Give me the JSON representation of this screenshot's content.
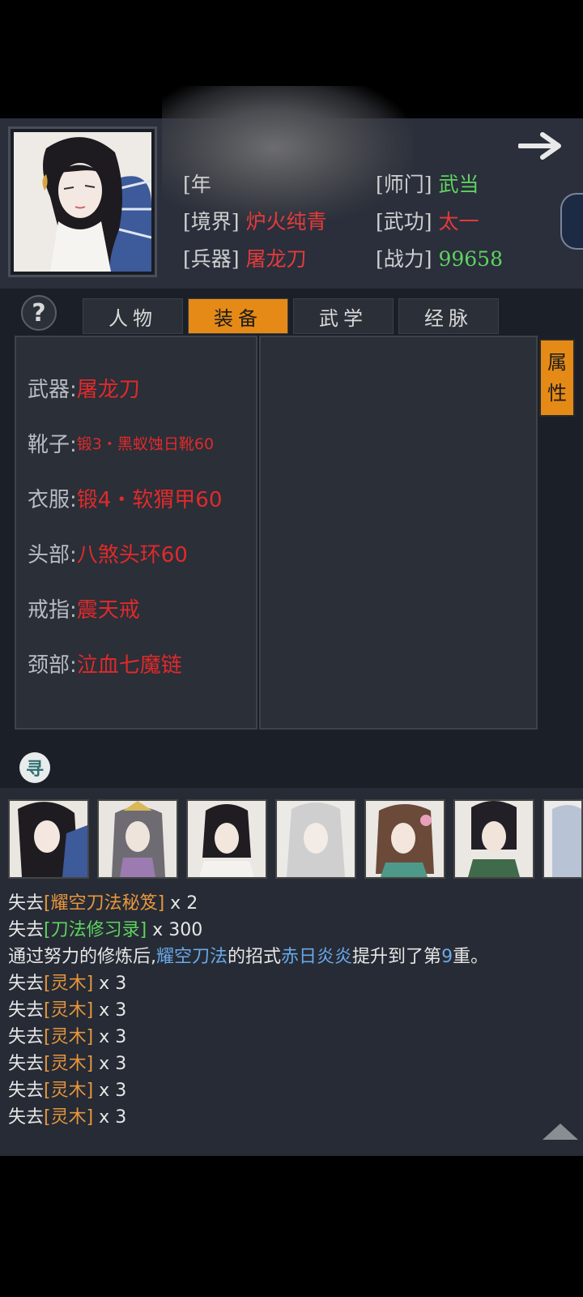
{
  "header": {
    "age_label": "[年",
    "realm_label": "[境界]",
    "realm_value": "炉火纯青",
    "weapon_label": "[兵器]",
    "weapon_value": "屠龙刀",
    "sect_label": "[师门]",
    "sect_value": "武当",
    "skill_label": "[武功]",
    "skill_value": "太一",
    "power_label": "[战力]",
    "power_value": "99658"
  },
  "help_label": "?",
  "tabs": [
    {
      "label": "人物"
    },
    {
      "label": "装备"
    },
    {
      "label": "武学"
    },
    {
      "label": "经脉"
    }
  ],
  "active_tab": "装备",
  "attr_button": {
    "line1": "属",
    "line2": "性"
  },
  "equipment": [
    {
      "label": "武器:",
      "value": "屠龙刀"
    },
    {
      "label": "靴子:",
      "value": "锻3・黑蚁蚀日靴60"
    },
    {
      "label": "衣服:",
      "value": "锻4・软猬甲60"
    },
    {
      "label": "头部:",
      "value": "八煞头环60"
    },
    {
      "label": "戒指:",
      "value": "震天戒"
    },
    {
      "label": "颈部:",
      "value": "泣血七魔链"
    }
  ],
  "log_icon_glyph": "寻",
  "log": {
    "line1": {
      "a": "失去",
      "b": "[耀空刀法秘笈]",
      "c": " x 2"
    },
    "line2": {
      "a": "失去",
      "b": "[刀法修习录]",
      "c": " x 300"
    },
    "line3": {
      "a": "通过努力的修炼后,",
      "b": "耀空刀法",
      "c": "的招式",
      "d": "赤日炎炎",
      "e": "提升到了第",
      "f": "9",
      "g": "重。"
    },
    "wood": {
      "a": "失去",
      "b": "[灵木]",
      "c": " x 3"
    }
  },
  "colors": {
    "accent": "#e58a16",
    "red": "#e23b3b",
    "green": "#5fd35f",
    "blue": "#6aa8e8",
    "orange": "#e8963c"
  }
}
